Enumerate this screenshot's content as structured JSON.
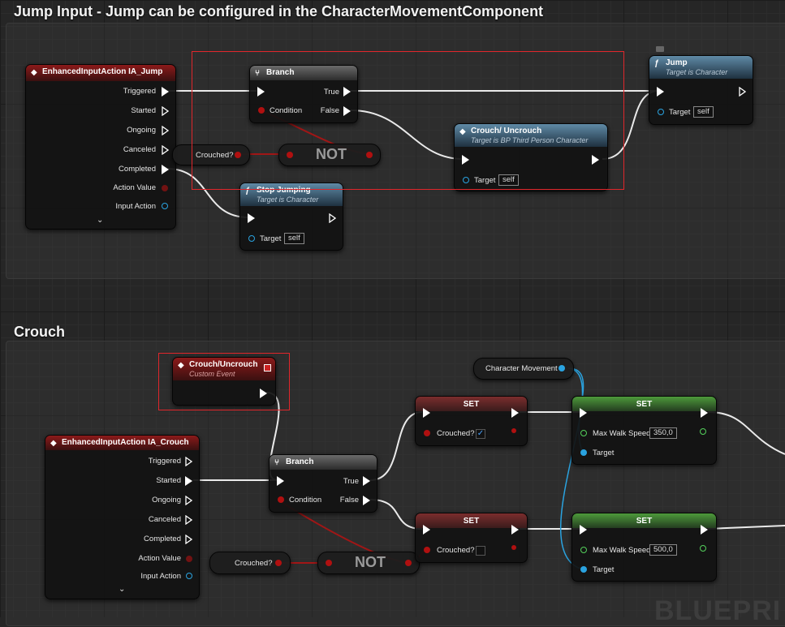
{
  "sections": {
    "jump_title": "Jump Input - Jump can be configured in the CharacterMovementComponent",
    "crouch_title": "Crouch"
  },
  "jump": {
    "input_node": {
      "title": "EnhancedInputAction IA_Jump",
      "pins": [
        "Triggered",
        "Started",
        "Ongoing",
        "Canceled",
        "Completed",
        "Action Value",
        "Input Action"
      ]
    },
    "branch": {
      "title": "Branch",
      "true_label": "True",
      "condition_label": "Condition",
      "false_label": "False"
    },
    "crouched_getter": "Crouched?",
    "not_label": "NOT",
    "stop_jumping": {
      "title": "Stop Jumping",
      "subtitle": "Target is Character",
      "target_label": "Target",
      "target_value": "self"
    },
    "crouch_uncrouch_call": {
      "title": "Crouch/ Uncrouch",
      "subtitle": "Target is BP Third Person Character",
      "target_label": "Target",
      "target_value": "self"
    },
    "jump_node": {
      "title": "Jump",
      "subtitle": "Target is Character",
      "target_label": "Target",
      "target_value": "self"
    }
  },
  "crouch": {
    "custom_event": {
      "title": "Crouch/Uncrouch",
      "subtitle": "Custom Event"
    },
    "input_node": {
      "title": "EnhancedInputAction IA_Crouch",
      "pins": [
        "Triggered",
        "Started",
        "Ongoing",
        "Canceled",
        "Completed",
        "Action Value",
        "Input Action"
      ]
    },
    "branch": {
      "title": "Branch",
      "true_label": "True",
      "condition_label": "Condition",
      "false_label": "False"
    },
    "crouched_getter": "Crouched?",
    "not_label": "NOT",
    "character_movement": "Character Movement",
    "set_true": {
      "title": "SET",
      "var_label": "Crouched?",
      "checked": true
    },
    "set_false": {
      "title": "SET",
      "var_label": "Crouched?",
      "checked": false
    },
    "set_speed_1": {
      "title": "SET",
      "var_label": "Max Walk Speed",
      "value": "350,0",
      "target_label": "Target"
    },
    "set_speed_2": {
      "title": "SET",
      "var_label": "Max Walk Speed",
      "value": "500,0",
      "target_label": "Target"
    }
  },
  "watermark": "BLUEPRI",
  "colors": {
    "highlight": "#e0262b",
    "exec": "#ffffff",
    "bool": "#b01010",
    "object": "#2aa3e0",
    "float": "#54d15b"
  }
}
